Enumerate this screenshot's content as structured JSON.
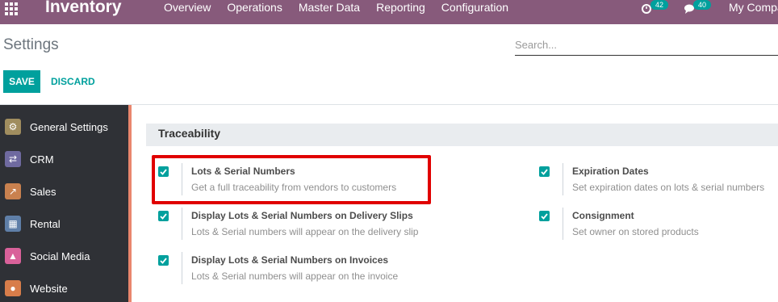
{
  "navbar": {
    "brand": "Inventory",
    "menu": [
      "Overview",
      "Operations",
      "Master Data",
      "Reporting",
      "Configuration"
    ],
    "activity_count": "42",
    "messages_count": "40",
    "company": "My Company"
  },
  "control_panel": {
    "title": "Settings",
    "search_placeholder": "Search...",
    "save_label": "SAVE",
    "discard_label": "DISCARD"
  },
  "sidebar": {
    "items": [
      {
        "label": "General Settings",
        "icon": "gear-icon",
        "color": "#a08d5f"
      },
      {
        "label": "CRM",
        "icon": "handshake-icon",
        "color": "#6f6aa0"
      },
      {
        "label": "Sales",
        "icon": "chart-icon",
        "color": "#c9814f"
      },
      {
        "label": "Rental",
        "icon": "rental-icon",
        "color": "#5f7fa8"
      },
      {
        "label": "Social Media",
        "icon": "thumbs-up-icon",
        "color": "#d9619a"
      },
      {
        "label": "Website",
        "icon": "globe-icon",
        "color": "#d87d4a"
      }
    ]
  },
  "section": {
    "title": "Traceability"
  },
  "settings": {
    "lots": {
      "title": "Lots & Serial Numbers",
      "desc": "Get a full traceability from vendors to customers"
    },
    "delivery": {
      "title": "Display Lots & Serial Numbers on Delivery Slips",
      "desc": "Lots & Serial numbers will appear on the delivery slip"
    },
    "invoices": {
      "title": "Display Lots & Serial Numbers on Invoices",
      "desc": "Lots & Serial numbers will appear on the invoice"
    },
    "expiration": {
      "title": "Expiration Dates",
      "desc": "Set expiration dates on lots & serial numbers"
    },
    "consignment": {
      "title": "Consignment",
      "desc": "Set owner on stored products"
    }
  },
  "colors": {
    "navbar": "#875a7b",
    "accent": "#00a09d",
    "highlight": "#e00000"
  }
}
